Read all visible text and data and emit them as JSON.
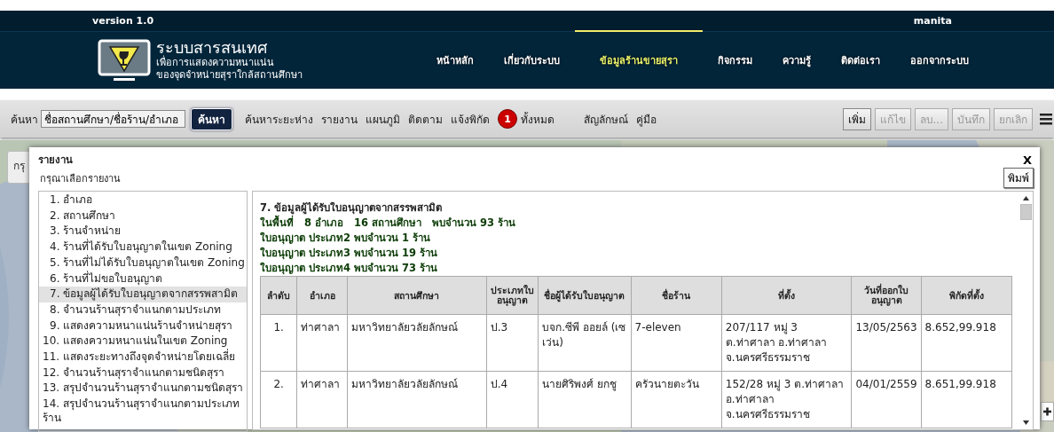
{
  "header": {
    "version": "version 1.0",
    "user": "manita",
    "title": "ระบบสารสนเทศ",
    "subtitle_lines": [
      "เพื่อการแสดงความหนาแน่น",
      "ของจุดจำหน่ายสุราใกล้สถานศึกษา"
    ]
  },
  "nav": [
    {
      "label": "หน้าหลัก",
      "selected": false
    },
    {
      "label": "เกี่ยวกับระบบ",
      "selected": false
    },
    {
      "label": "ข้อมูลร้านขายสุรา",
      "selected": true
    },
    {
      "label": "กิจกรรม",
      "selected": false
    },
    {
      "label": "ความรู้",
      "selected": false
    },
    {
      "label": "ติดต่อเรา",
      "selected": false
    },
    {
      "label": "ออกจากระบบ",
      "selected": false
    }
  ],
  "toolbar": {
    "search_label": "ค้นหา",
    "search_value": "ชื่อสถานศึกษา/ชื่อร้าน/อำเภอ",
    "search_button": "ค้นหา",
    "links": [
      {
        "kind": "link",
        "label": "ค้นหาระยะห่าง"
      },
      {
        "kind": "link",
        "label": "รายงาน"
      },
      {
        "kind": "link",
        "label": "แผนภูมิ"
      },
      {
        "kind": "link",
        "label": "ติดตาม"
      },
      {
        "kind": "link",
        "label": "แจ้งพิกัด"
      },
      {
        "kind": "badge",
        "count": "1",
        "label": "ทั้งหมด"
      },
      {
        "kind": "link",
        "label": "สัญลักษณ์"
      },
      {
        "kind": "link",
        "label": "คู่มือ"
      }
    ],
    "buttons": [
      {
        "label": "เพิ่ม",
        "disabled": false
      },
      {
        "label": "แก้ไข",
        "disabled": true
      },
      {
        "label": "ลบ...",
        "disabled": true
      },
      {
        "label": "บันทึก",
        "disabled": true
      },
      {
        "label": "ยกเลิก",
        "disabled": true
      }
    ]
  },
  "map": {
    "kind": "picture",
    "tab_label": "กรุ"
  },
  "dialog": {
    "title": "รายงาน",
    "close": "X",
    "subtitle": "กรุณาเลือกรายงาน",
    "print_button": "พิมพ์",
    "reports": [
      {
        "label": "1. อำเภอ",
        "selected": false
      },
      {
        "label": "2. สถานศึกษา",
        "selected": false
      },
      {
        "label": "3. ร้านจำหน่าย",
        "selected": false
      },
      {
        "label": "4. ร้านที่ได้รับใบอนุญาตในเขต Zoning",
        "selected": false
      },
      {
        "label": "5. ร้านที่ไม่ได้รับใบอนุญาตในเขต Zoning",
        "selected": false
      },
      {
        "label": "6. ร้านที่ไม่ขอใบอนุญาต",
        "selected": false
      },
      {
        "label": "7. ข้อมูลผู้ได้รับใบอนุญาตจากสรรพสามิต",
        "selected": true
      },
      {
        "label": "8. จำนวนร้านสุราจำแนกตามประเภท",
        "selected": false
      },
      {
        "label": "9. แสดงความหนาแน่นร้านจำหน่ายสุรา",
        "selected": false
      },
      {
        "label": "10. แสดงความหนาแน่นในเขต Zoning",
        "selected": false
      },
      {
        "label": "11. แสดงระยะทางถึงจุดจำหน่ายโดยเฉลี่ย",
        "selected": false
      },
      {
        "label": "12. จำนวนร้านสุราจำแนกตามชนิดสุรา",
        "selected": false
      },
      {
        "label": "13. สรุปจำนวนร้านสุราจำแนกตามชนิดสุรา",
        "selected": false
      },
      {
        "label": "14. สรุปจำนวนร้านสุราจำแนกตามประเภทร้าน",
        "selected": false
      }
    ],
    "report": {
      "lines": [
        {
          "kind": "heading",
          "text": "7. ข้อมูลผู้ได้รับใบอนุญาตจากสรรพสามิต"
        },
        {
          "kind": "summary",
          "text": "ในพื้นที่   8 อำเภอ   16 สถานศึกษา   พบจำนวน 93 ร้าน"
        },
        {
          "kind": "summary",
          "text": "ใบอนุญาต ประเภท2 พบจำนวน 1 ร้าน"
        },
        {
          "kind": "summary",
          "text": "ใบอนุญาต ประเภท3 พบจำนวน 19 ร้าน"
        },
        {
          "kind": "summary",
          "text": "ใบอนุญาต ประเภท4 พบจำนวน 73 ร้าน"
        }
      ],
      "columns": [
        "ลำดับ",
        "อำเภอ",
        "สถานศึกษา",
        "ประเภทใบอนุญาต",
        "ชื่อผู้ได้รับใบอนุญาต",
        "ชื่อร้าน",
        "ที่ตั้ง",
        "วันที่ออกใบอนุญาต",
        "พิกัดที่ตั้ง"
      ],
      "rows": [
        [
          "1.",
          "ท่าศาลา",
          "มหาวิทยาลัยวลัยลักษณ์",
          "ป.3",
          "บจก.ซีพี ออยล์ (เซเว่น)",
          "7-eleven",
          "207/117 หมู่ 3 ต.ท่าศาลา อ.ท่าศาลา จ.นครศรีธรรมราช",
          "13/05/2563",
          "8.652,99.918"
        ],
        [
          "2.",
          "ท่าศาลา",
          "มหาวิทยาลัยวลัยลักษณ์",
          "ป.4",
          "นายศิริพงศ์ ยกชู",
          "ครัวนายตะวัน",
          "152/28 หมู่ 3 ต.ท่าศาลา อ.ท่าศาลา จ.นครศรีธรรมราช",
          "04/01/2559",
          "8.651,99.918"
        ]
      ]
    }
  }
}
